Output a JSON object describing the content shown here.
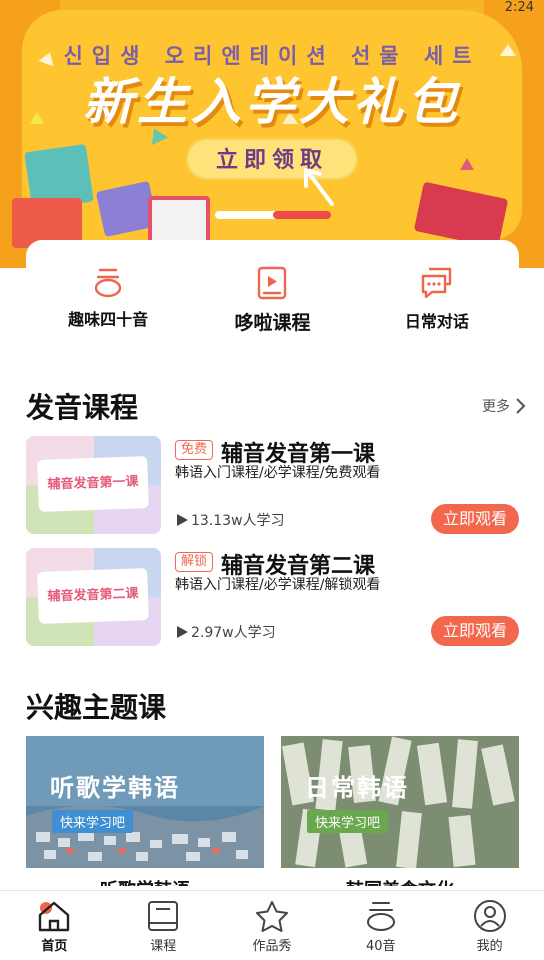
{
  "status_bar": {
    "time": "2:24"
  },
  "banner": {
    "korean_text": "신입생 오리엔테이션 선물 세트",
    "title": "新生入学大礼包",
    "cta": "立即领取",
    "slider_progress": 0.5
  },
  "categories": [
    {
      "label": "趣味四十音",
      "icon": "pronunciation-icon"
    },
    {
      "label": "哆啦课程",
      "icon": "video-course-icon"
    },
    {
      "label": "日常对话",
      "icon": "chat-bubbles-icon"
    }
  ],
  "pronunciation_section": {
    "title": "发音课程",
    "more": "更多",
    "courses": [
      {
        "thumb_text": "辅音发音第一课",
        "badge": "免费",
        "title": "辅音发音第一课",
        "subtitle": "韩语入门课程/必学课程/免费观看",
        "views": "13.13w人学习",
        "button": "立即观看"
      },
      {
        "thumb_text": "辅音发音第二课",
        "badge": "解锁",
        "title": "辅音发音第二课",
        "subtitle": "韩语入门课程/必学课程/解锁观看",
        "views": "2.97w人学习",
        "button": "立即观看"
      }
    ]
  },
  "theme_section": {
    "title": "兴趣主题课",
    "cards": [
      {
        "title": "听歌学韩语",
        "tag": "快来学习吧",
        "caption": "听歌学韩语",
        "tag_color": "#3f8fd2"
      },
      {
        "title": "日常韩语",
        "tag": "快来学习吧",
        "caption": "韩国美食文化",
        "tag_color": "#6aa84f"
      }
    ]
  },
  "bottom_nav": [
    {
      "label": "首页",
      "icon": "home-icon",
      "active": true
    },
    {
      "label": "课程",
      "icon": "book-icon",
      "active": false
    },
    {
      "label": "作品秀",
      "icon": "star-icon",
      "active": false
    },
    {
      "label": "40音",
      "icon": "pronunciation-icon",
      "active": false
    },
    {
      "label": "我的",
      "icon": "profile-icon",
      "active": false
    }
  ],
  "colors": {
    "accent": "#f3674c",
    "banner_bg": "#f7b425",
    "banner_title_shadow": "#e38b10"
  }
}
